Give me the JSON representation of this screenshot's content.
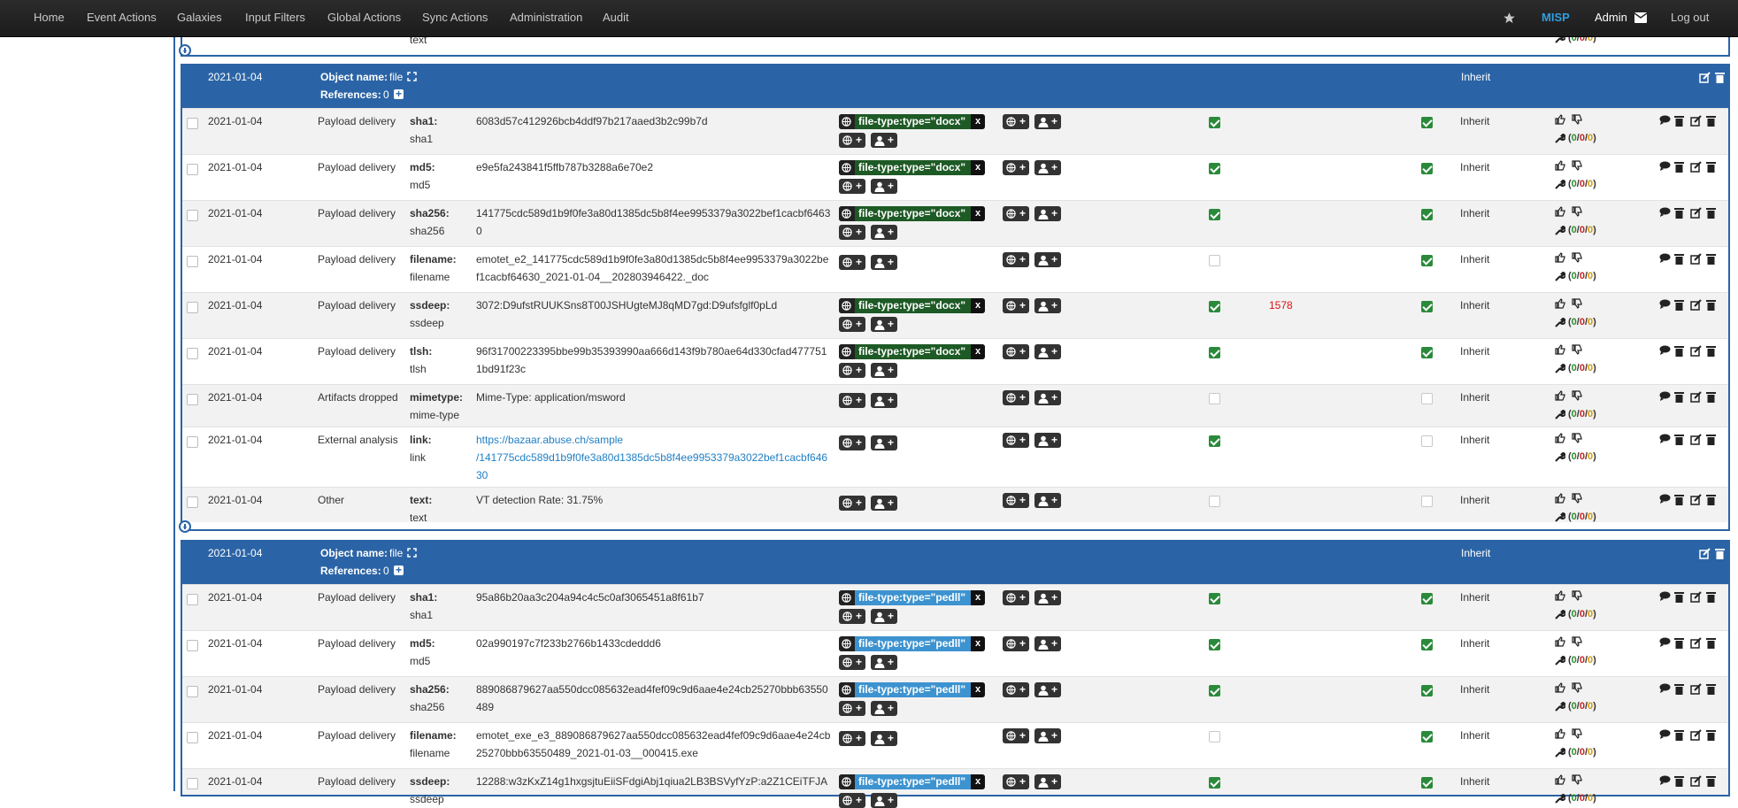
{
  "nav": {
    "items": [
      "Home",
      "Event Actions",
      "Galaxies",
      "Input Filters",
      "Global Actions",
      "Sync Actions",
      "Administration",
      "Audit"
    ],
    "brand": "MISP",
    "user": "Admin",
    "logout": "Log out"
  },
  "top_partial": {
    "type_label": "text",
    "score": {
      "open": "(",
      "a": "0",
      "s1": "/",
      "b": "0",
      "s2": "/",
      "c": "0",
      "close": ")"
    }
  },
  "common": {
    "score": {
      "open": "(",
      "a": "0",
      "s1": "/",
      "b": "0",
      "s2": "/",
      "c": "0",
      "close": ")"
    },
    "inherit": "Inherit",
    "tag_close": "x"
  },
  "objects": [
    {
      "date": "2021-01-04",
      "name_label": "Object name:",
      "name_value": "file",
      "references_label": "References:",
      "references_value": "0",
      "distribution": "Inherit",
      "rows": [
        {
          "date": "2021-01-04",
          "category": "Payload delivery",
          "relation": "sha1:",
          "type": "sha1",
          "value": [
            "6083d57c412926bcb4ddf97b217aaed3b2c99b7d"
          ],
          "tag": "file-type:type=\"docx\"",
          "tag_color": "green",
          "ids": true,
          "correlation": "",
          "correlate": true,
          "distribution": "Inherit"
        },
        {
          "date": "2021-01-04",
          "category": "Payload delivery",
          "relation": "md5:",
          "type": "md5",
          "value": [
            "e9e5fa243841f5ffb787b3288a6e70e2"
          ],
          "tag": "file-type:type=\"docx\"",
          "tag_color": "green",
          "ids": true,
          "correlation": "",
          "correlate": true,
          "distribution": "Inherit"
        },
        {
          "date": "2021-01-04",
          "category": "Payload delivery",
          "relation": "sha256:",
          "type": "sha256",
          "value": [
            "141775cdc589d1b9f0fe3a80d1385dc5b8f4ee9953379a3022bef1cacbf6463",
            "0"
          ],
          "tag": "file-type:type=\"docx\"",
          "tag_color": "green",
          "ids": true,
          "correlation": "",
          "correlate": true,
          "distribution": "Inherit"
        },
        {
          "date": "2021-01-04",
          "category": "Payload delivery",
          "relation": "filename:",
          "type": "filename",
          "value": [
            "emotet_e2_141775cdc589d1b9f0fe3a80d1385dc5b8f4ee9953379a3022be",
            "f1cacbf64630_2021-01-04__202803946422._doc"
          ],
          "tag": "",
          "tag_color": "",
          "ids": false,
          "correlation": "",
          "correlate": true,
          "distribution": "Inherit"
        },
        {
          "date": "2021-01-04",
          "category": "Payload delivery",
          "relation": "ssdeep:",
          "type": "ssdeep",
          "value": [
            "3072:D9ufstRUUKSns8T00JSHUgteMJ8qMD7gd:D9ufsfglf0pLd"
          ],
          "tag": "file-type:type=\"docx\"",
          "tag_color": "green",
          "ids": true,
          "correlation": "1578",
          "correlate": true,
          "distribution": "Inherit"
        },
        {
          "date": "2021-01-04",
          "category": "Payload delivery",
          "relation": "tlsh:",
          "type": "tlsh",
          "value": [
            "96f31700223395bbe99b35393990aa666d143f9b780ae64d330cfad477751",
            "1bd91f23c"
          ],
          "tag": "file-type:type=\"docx\"",
          "tag_color": "green",
          "ids": true,
          "correlation": "",
          "correlate": true,
          "distribution": "Inherit"
        },
        {
          "date": "2021-01-04",
          "category": "Artifacts dropped",
          "relation": "mimetype:",
          "type": "mime-type",
          "value": [
            "Mime-Type: application/msword"
          ],
          "tag": "",
          "tag_color": "",
          "ids": false,
          "correlation": "",
          "correlate": false,
          "distribution": "Inherit"
        },
        {
          "date": "2021-01-04",
          "category": "External analysis",
          "relation": "link:",
          "type": "link",
          "value": [
            "https://bazaar.abuse.ch/sample",
            "/141775cdc589d1b9f0fe3a80d1385dc5b8f4ee9953379a3022bef1cacbf646",
            "30"
          ],
          "is_link": true,
          "tag": "",
          "tag_color": "",
          "ids": true,
          "correlation": "",
          "correlate": false,
          "distribution": "Inherit"
        },
        {
          "date": "2021-01-04",
          "category": "Other",
          "relation": "text:",
          "type": "text",
          "value": [
            "VT detection Rate: 31.75%"
          ],
          "tag": "",
          "tag_color": "",
          "ids": false,
          "correlation": "",
          "correlate": false,
          "distribution": "Inherit"
        }
      ]
    },
    {
      "date": "2021-01-04",
      "name_label": "Object name:",
      "name_value": "file",
      "references_label": "References:",
      "references_value": "0",
      "distribution": "Inherit",
      "rows": [
        {
          "date": "2021-01-04",
          "category": "Payload delivery",
          "relation": "sha1:",
          "type": "sha1",
          "value": [
            "95a86b20aa3c204a94c4c5c0af3065451a8f61b7"
          ],
          "tag": "file-type:type=\"pedll\"",
          "tag_color": "blue",
          "ids": true,
          "correlation": "",
          "correlate": true,
          "distribution": "Inherit"
        },
        {
          "date": "2021-01-04",
          "category": "Payload delivery",
          "relation": "md5:",
          "type": "md5",
          "value": [
            "02a990197c7f233b2766b1433cdeddd6"
          ],
          "tag": "file-type:type=\"pedll\"",
          "tag_color": "blue",
          "ids": true,
          "correlation": "",
          "correlate": true,
          "distribution": "Inherit"
        },
        {
          "date": "2021-01-04",
          "category": "Payload delivery",
          "relation": "sha256:",
          "type": "sha256",
          "value": [
            "889086879627aa550dcc085632ead4fef09c9d6aae4e24cb25270bbb63550",
            "489"
          ],
          "tag": "file-type:type=\"pedll\"",
          "tag_color": "blue",
          "ids": true,
          "correlation": "",
          "correlate": true,
          "distribution": "Inherit"
        },
        {
          "date": "2021-01-04",
          "category": "Payload delivery",
          "relation": "filename:",
          "type": "filename",
          "value": [
            "emotet_exe_e3_889086879627aa550dcc085632ead4fef09c9d6aae4e24cb",
            "25270bbb63550489_2021-01-03__000415.exe"
          ],
          "tag": "",
          "tag_color": "",
          "ids": false,
          "correlation": "",
          "correlate": true,
          "distribution": "Inherit"
        },
        {
          "date": "2021-01-04",
          "category": "Payload delivery",
          "relation": "ssdeep:",
          "type": "ssdeep",
          "value": [
            "12288:w3zKxZ14g1hxgsjtuEiiSFdgiAbj1qiua2LB3BSVyfYzP:a2Z1CEiTFJA"
          ],
          "tag": "file-type:type=\"pedll\"",
          "tag_color": "blue",
          "ids": true,
          "correlation": "",
          "correlate": true,
          "distribution": "Inherit"
        }
      ]
    }
  ]
}
